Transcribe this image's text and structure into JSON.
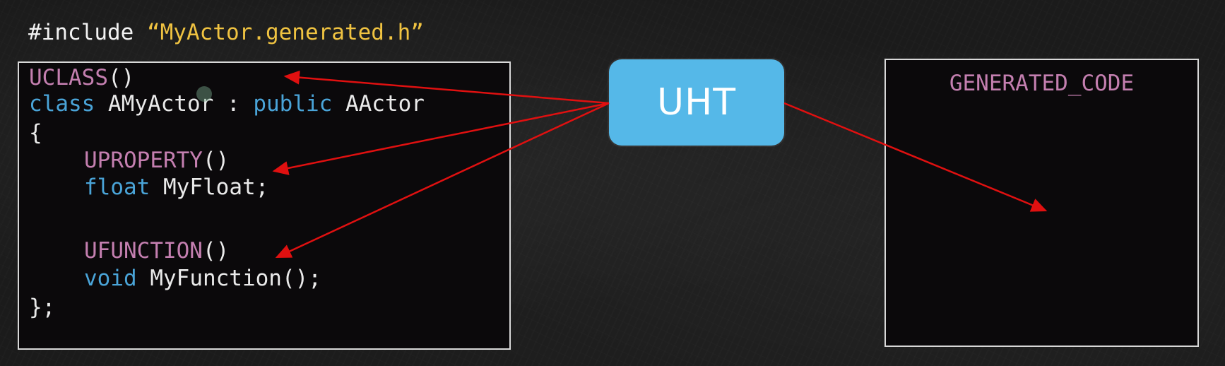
{
  "include": {
    "directive": "#include ",
    "file": "“MyActor.generated.h”"
  },
  "code": {
    "uclass": "UCLASS",
    "uclass_parens": "()",
    "kw_class": "class",
    "class_name": "AMyActor",
    "colon": ":",
    "kw_public": "public",
    "base_class": "AActor",
    "open_brace": "{",
    "uproperty": "UPROPERTY",
    "uproperty_parens": "()",
    "kw_float": "float",
    "float_decl": "MyFloat;",
    "ufunction": "UFUNCTION",
    "ufunction_parens": "()",
    "kw_void": "void",
    "func_decl": "MyFunction();",
    "close_brace": "};"
  },
  "uht": {
    "label": "UHT"
  },
  "generated": {
    "label": "GENERATED_CODE"
  },
  "colors": {
    "keyword_blue": "#4aa4d8",
    "macro_purple": "#c47fb0",
    "string_yellow": "#f0c341",
    "uht_box": "#55b8e8",
    "arrow_red": "#e01010"
  }
}
